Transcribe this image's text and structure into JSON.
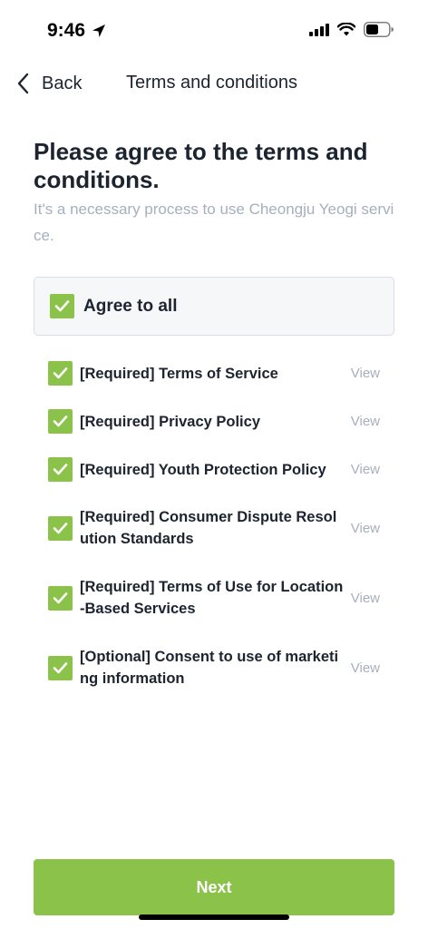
{
  "status_bar": {
    "time": "9:46"
  },
  "nav": {
    "back_label": "Back",
    "title": "Terms and conditions"
  },
  "headline": "Please agree to the terms and conditions.",
  "subtext": "It's a necessary process to use Cheongju Yeogi service.",
  "agree_all": {
    "label": "Agree to all",
    "checked": true
  },
  "terms": [
    {
      "label": "[Required] Terms of Service",
      "view": "View",
      "checked": true
    },
    {
      "label": "[Required] Privacy Policy",
      "view": "View",
      "checked": true
    },
    {
      "label": "[Required] Youth Protection Policy",
      "view": "View",
      "checked": true
    },
    {
      "label": "[Required] Consumer Dispute Resolution Standards",
      "view": "View",
      "checked": true
    },
    {
      "label": "[Required] Terms of Use for Location-Based Services",
      "view": "View",
      "checked": true
    },
    {
      "label": "[Optional] Consent to use of marketing information",
      "view": "View",
      "checked": true
    }
  ],
  "next_button": "Next",
  "colors": {
    "accent": "#8bc34a",
    "text": "#1c2430",
    "muted": "#a7afbd"
  }
}
